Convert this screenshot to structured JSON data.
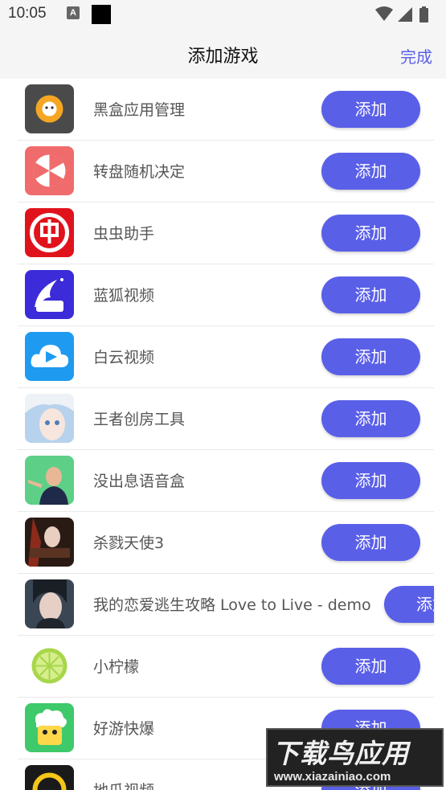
{
  "status_bar": {
    "time": "10:05",
    "notification_glyph": "A"
  },
  "header": {
    "title": "添加游戏",
    "done_label": "完成"
  },
  "add_label": "添加",
  "apps": [
    {
      "name": "黑盒应用管理",
      "icon": "black-box-icon"
    },
    {
      "name": "转盘随机决定",
      "icon": "spin-wheel-icon"
    },
    {
      "name": "虫虫助手",
      "icon": "chongchong-icon"
    },
    {
      "name": "蓝狐视频",
      "icon": "blue-fox-icon"
    },
    {
      "name": "白云视频",
      "icon": "white-cloud-icon"
    },
    {
      "name": "王者创房工具",
      "icon": "anime-character-icon"
    },
    {
      "name": "没出息语音盒",
      "icon": "voice-box-icon"
    },
    {
      "name": "杀戮天使3",
      "icon": "angel-game-icon"
    },
    {
      "name": "我的恋爱逃生攻略 Love to Live - demo",
      "icon": "love-game-icon"
    },
    {
      "name": "小柠檬",
      "icon": "lemon-icon"
    },
    {
      "name": "好游快爆",
      "icon": "haoyou-icon"
    },
    {
      "name": "地瓜视频",
      "icon": "video-app-icon"
    }
  ],
  "watermark": {
    "title": "下载鸟应用",
    "url": "www.xiazainiao.com"
  }
}
